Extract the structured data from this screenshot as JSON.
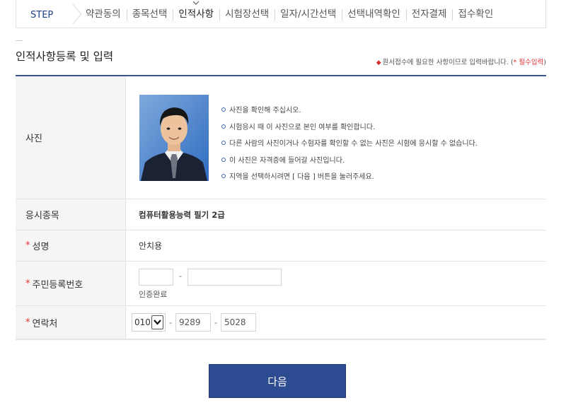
{
  "step_bar": {
    "label": "STEP",
    "steps": [
      {
        "label": "약관동의",
        "current": false
      },
      {
        "label": "종목선택",
        "current": false
      },
      {
        "label": "인적사항",
        "current": true
      },
      {
        "label": "시험장선택",
        "current": false
      },
      {
        "label": "일자/시간선택",
        "current": false
      },
      {
        "label": "선택내역확인",
        "current": false
      },
      {
        "label": "전자결제",
        "current": false
      },
      {
        "label": "접수확인",
        "current": false
      }
    ]
  },
  "section": {
    "title": "인적사항등록 및 입력",
    "note_text": "원서접수에 필요한 사항이므로 입력바랍니다. (",
    "note_required": "* 필수입력",
    "note_close": ")"
  },
  "form": {
    "photo": {
      "label": "사진",
      "notes": [
        "사진을 확인해 주십시오.",
        "시험응시 때 이 사진으로 본인 여부를 확인합니다.",
        "다른 사람의 사진이거나 수험자를 확인할 수 없는 사진은 시험에 응시할 수 없습니다.",
        "이 사진은 자격증에 들어갈 사진입니다.",
        "지역을 선택하시려면 [ 다음 ] 버튼을 눌러주세요."
      ]
    },
    "exam": {
      "label": "응시종목",
      "value": "컴퓨터활용능력 필기 2급"
    },
    "name": {
      "required_mark": "*",
      "label": "성명",
      "value": "안치용"
    },
    "resident_id": {
      "required_mark": "*",
      "label": "주민등록번호",
      "first": "",
      "second": "",
      "separator": "-",
      "status": "인증완료"
    },
    "phone": {
      "required_mark": "*",
      "label": "연락처",
      "area": "010",
      "middle": "9289",
      "last": "5028",
      "separator": "-"
    }
  },
  "next_button": {
    "label": "다음"
  },
  "colors": {
    "accent": "#2c4b91",
    "required": "#e3342f",
    "label_bg": "#f5f5f5"
  }
}
